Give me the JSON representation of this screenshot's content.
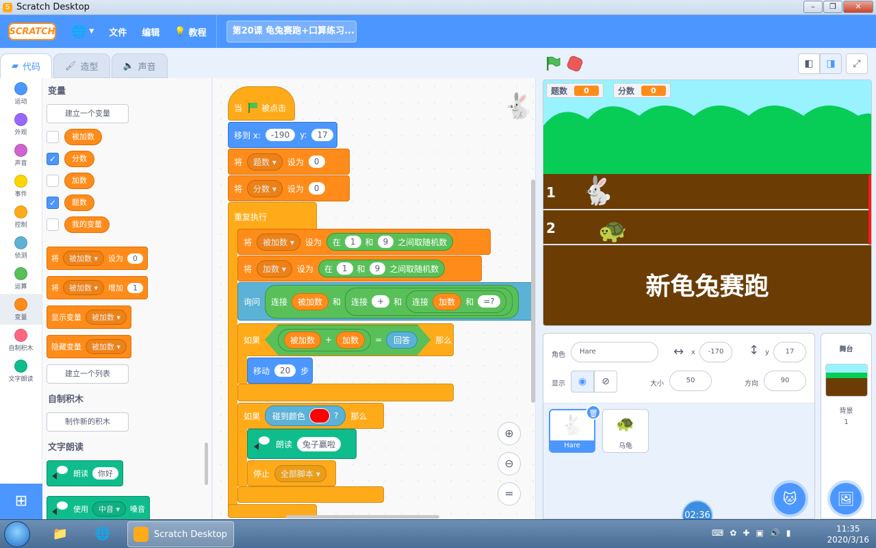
{
  "window": {
    "title": "Scratch Desktop"
  },
  "menu": {
    "logo": "SCRATCH",
    "file": "文件",
    "edit": "编辑",
    "tutorials": "教程",
    "project_title": "第20课 龟兔赛跑+口算练习..."
  },
  "tabs": {
    "code": "代码",
    "costumes": "造型",
    "sounds": "声音"
  },
  "categories": [
    {
      "label": "运动",
      "color": "#4c97ff"
    },
    {
      "label": "外观",
      "color": "#9966ff"
    },
    {
      "label": "声音",
      "color": "#cf63cf"
    },
    {
      "label": "事件",
      "color": "#ffd500"
    },
    {
      "label": "控制",
      "color": "#ffab19"
    },
    {
      "label": "侦测",
      "color": "#5cb1d6"
    },
    {
      "label": "运算",
      "color": "#59c059"
    },
    {
      "label": "变量",
      "color": "#ff8c1a"
    },
    {
      "label": "自制积木",
      "color": "#ff6680"
    },
    {
      "label": "文字朗读",
      "color": "#0fbd8c"
    }
  ],
  "palette": {
    "variables_heading": "变量",
    "make_variable": "建立一个变量",
    "variables": [
      {
        "name": "被加数",
        "checked": false
      },
      {
        "name": "分数",
        "checked": true
      },
      {
        "name": "加数",
        "checked": false
      },
      {
        "name": "题数",
        "checked": true
      },
      {
        "name": "我的变量",
        "checked": false
      }
    ],
    "set_block": {
      "a": "将",
      "var": "被加数",
      "b": "设为",
      "val": "0"
    },
    "change_block": {
      "a": "将",
      "var": "被加数",
      "b": "增加",
      "val": "1"
    },
    "show_block": {
      "a": "显示变量",
      "var": "被加数"
    },
    "hide_block": {
      "a": "隐藏变量",
      "var": "被加数"
    },
    "make_list": "建立一个列表",
    "my_blocks_heading": "自制积木",
    "make_block": "制作新的积木",
    "tts_heading": "文字朗读",
    "speak_block": {
      "a": "朗读",
      "val": "你好"
    },
    "voice_block": {
      "a": "使用",
      "val": "中音",
      "b": "嗓音"
    }
  },
  "script": {
    "when_flag": {
      "a": "当",
      "b": "被点击"
    },
    "goto": {
      "a": "移到 x:",
      "x": "-190",
      "b": "y:",
      "y": "17"
    },
    "set1": {
      "a": "将",
      "var": "题数",
      "b": "设为",
      "val": "0"
    },
    "set2": {
      "a": "将",
      "var": "分数",
      "b": "设为",
      "val": "0"
    },
    "forever": "重复执行",
    "set3": {
      "a": "将",
      "var": "被加数",
      "b": "设为",
      "c": "在",
      "v1": "1",
      "d": "和",
      "v2": "9",
      "e": "之间取随机数"
    },
    "set4": {
      "a": "将",
      "var": "加数",
      "b": "设为",
      "c": "在",
      "v1": "1",
      "d": "和",
      "v2": "9",
      "e": "之间取随机数"
    },
    "ask": {
      "a": "询问",
      "j": "连接",
      "r1": "被加数",
      "and": "和",
      "plus": "+",
      "r2": "加数",
      "eq": "=?"
    },
    "if1": {
      "a": "如果",
      "r1": "被加数",
      "op": "+",
      "r2": "加数",
      "eq": "=",
      "ans": "回答",
      "then": "那么"
    },
    "move": {
      "a": "移动",
      "val": "20",
      "b": "步"
    },
    "if2": {
      "a": "如果",
      "b": "碰到颜色",
      "q": "?",
      "then": "那么",
      "color": "#ff0000"
    },
    "speak": {
      "a": "朗读",
      "val": "兔子赢啦"
    },
    "stop": {
      "a": "停止",
      "val": "全部脚本"
    }
  },
  "stage": {
    "monitor1": {
      "label": "题数",
      "value": "0"
    },
    "monitor2": {
      "label": "分数",
      "value": "0"
    },
    "lane1": "1",
    "lane2": "2",
    "title": "新龟兔赛跑"
  },
  "sprite_info": {
    "sprite_label": "角色",
    "sprite_name": "Hare",
    "x_label": "x",
    "x": "-170",
    "y_label": "y",
    "y": "17",
    "show_label": "显示",
    "size_label": "大小",
    "size": "50",
    "direction_label": "方向",
    "direction": "90"
  },
  "sprites": [
    {
      "name": "Hare",
      "selected": true
    },
    {
      "name": "乌龟",
      "selected": false
    }
  ],
  "stage_pane": {
    "title": "舞台",
    "backdrop_label": "背景",
    "backdrop_count": "1"
  },
  "timer": "02:36",
  "taskbar": {
    "task_label": "Scratch Desktop",
    "time": "11:35",
    "date": "2020/3/16"
  }
}
